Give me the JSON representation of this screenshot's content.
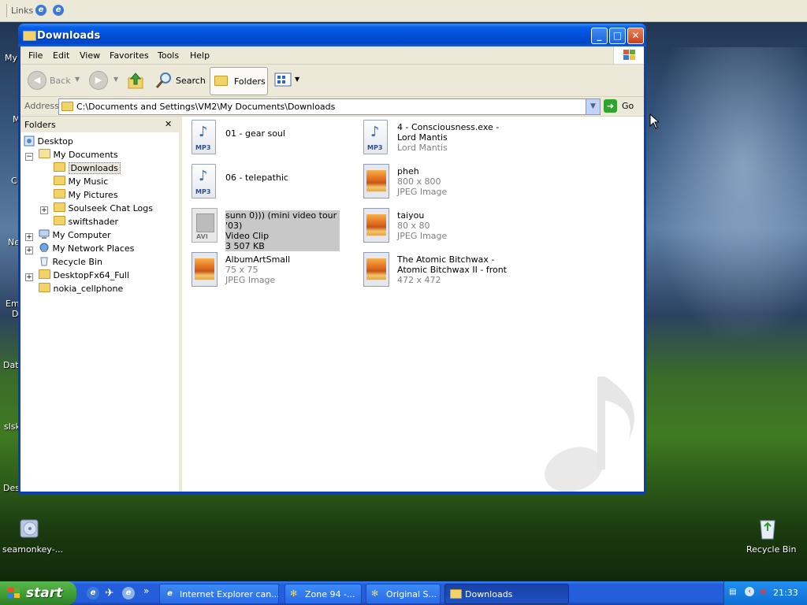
{
  "links_bar": {
    "label": "Links"
  },
  "desktop_left_labels": [
    "My",
    "M",
    "C",
    "Ne",
    "Em",
    "D",
    "Dat",
    "slsk",
    "Des"
  ],
  "desktop_icons": {
    "seamonkey": "seamonkey-...",
    "recycle_bin": "Recycle Bin"
  },
  "window": {
    "title": "Downloads",
    "buttons": {
      "minimize": "_",
      "maximize": "□",
      "close": "✕"
    },
    "menu": [
      "File",
      "Edit",
      "View",
      "Favorites",
      "Tools",
      "Help"
    ],
    "toolbar": {
      "back": "Back",
      "search": "Search",
      "folders": "Folders"
    },
    "address": {
      "label": "Address",
      "value": "C:\\Documents and Settings\\VM2\\My Documents\\Downloads",
      "go": "Go"
    },
    "folders_pane": {
      "title": "Folders",
      "close": "✕",
      "tree": [
        {
          "label": "Desktop",
          "level": 0
        },
        {
          "label": "My Documents",
          "level": 1,
          "expander": "−"
        },
        {
          "label": "Downloads",
          "level": 2,
          "selected": true
        },
        {
          "label": "My Music",
          "level": 2
        },
        {
          "label": "My Pictures",
          "level": 2
        },
        {
          "label": "Soulseek Chat Logs",
          "level": 2,
          "expander": "+"
        },
        {
          "label": "swiftshader",
          "level": 2
        },
        {
          "label": "My Computer",
          "level": 1,
          "expander": "+"
        },
        {
          "label": "My Network Places",
          "level": 1,
          "expander": "+"
        },
        {
          "label": "Recycle Bin",
          "level": 1
        },
        {
          "label": "DesktopFx64_Full",
          "level": 1,
          "expander": "+"
        },
        {
          "label": "nokia_cellphone",
          "level": 1
        }
      ]
    },
    "files": [
      {
        "name": "01 - gear soul",
        "type_icon": "mp3",
        "lines": []
      },
      {
        "name": "4 - Consciousness.exe - Lord Mantis",
        "type_icon": "mp3",
        "lines": [
          "Lord Mantis"
        ]
      },
      {
        "name": "06 - telepathic",
        "type_icon": "mp3",
        "lines": []
      },
      {
        "name": "pheh",
        "type_icon": "jpeg",
        "lines": [
          "800 x 800",
          "JPEG Image"
        ]
      },
      {
        "name": "sunn 0))) (mini video tour '03)",
        "type_icon": "avi",
        "lines": [
          "Video Clip",
          "3 507 KB"
        ],
        "selected": true
      },
      {
        "name": "taiyou",
        "type_icon": "jpeg",
        "lines": [
          "80 x 80",
          "JPEG Image"
        ]
      },
      {
        "name": "AlbumArtSmall",
        "type_icon": "jpeg",
        "lines": [
          "75 x 75",
          "JPEG Image"
        ]
      },
      {
        "name": "The Atomic Bitchwax - Atomic Bitchwax II - front",
        "type_icon": "jpeg",
        "lines": [
          "472 x 472"
        ]
      }
    ],
    "icon_labels": {
      "mp3": "MP3",
      "avi": "AVI"
    }
  },
  "taskbar": {
    "start": "start",
    "chevron": "»",
    "tasks": [
      {
        "label": "Internet Explorer can...",
        "icon": "ie-icon"
      },
      {
        "label": "Zone 94 -...",
        "icon": "winamp-icon"
      },
      {
        "label": "Original S...",
        "icon": "winamp-icon"
      },
      {
        "label": "Downloads",
        "icon": "folder-icon",
        "active": true
      }
    ],
    "clock": "21:33"
  }
}
